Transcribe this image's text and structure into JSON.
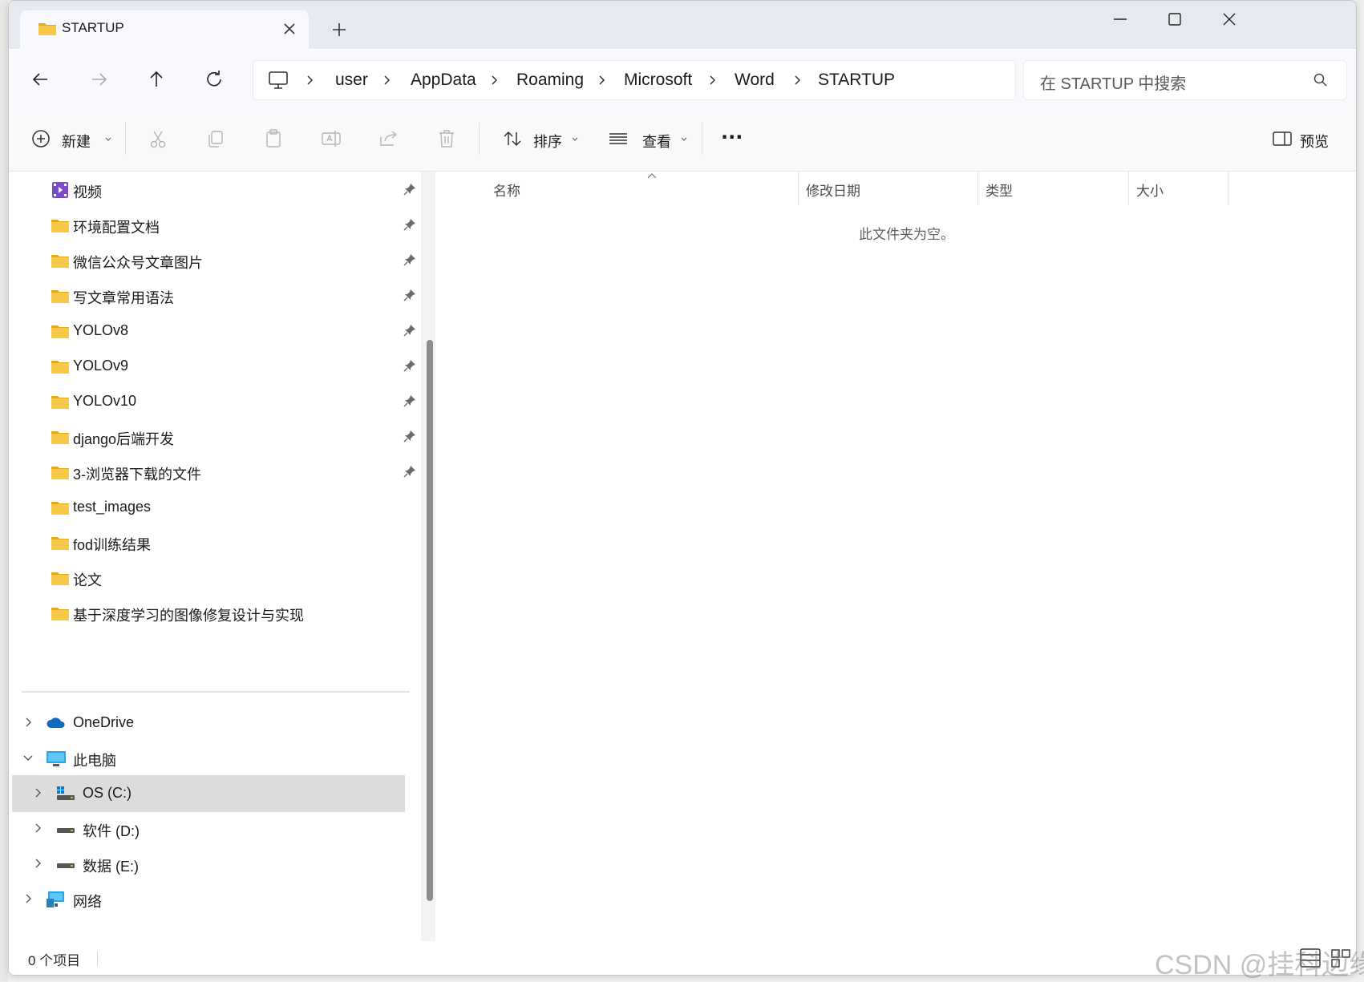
{
  "window": {
    "tab_title": "STARTUP",
    "new_tab_symbol": "+"
  },
  "address_bar": {
    "crumbs": [
      "user",
      "AppData",
      "Roaming",
      "Microsoft",
      "Word",
      "STARTUP"
    ]
  },
  "search": {
    "placeholder": "在 STARTUP 中搜索"
  },
  "toolbar": {
    "new_label": "新建",
    "sort_label": "排序",
    "view_label": "查看",
    "more_label": "···",
    "preview_label": "预览"
  },
  "sidebar": {
    "quick_access": [
      {
        "label": "视频",
        "icon": "video-folder-icon",
        "pinned": true
      },
      {
        "label": "环境配置文档",
        "icon": "folder-icon",
        "pinned": true
      },
      {
        "label": "微信公众号文章图片",
        "icon": "folder-icon",
        "pinned": true
      },
      {
        "label": "写文章常用语法",
        "icon": "folder-icon",
        "pinned": true
      },
      {
        "label": "YOLOv8",
        "icon": "folder-icon",
        "pinned": true
      },
      {
        "label": "YOLOv9",
        "icon": "folder-icon",
        "pinned": true
      },
      {
        "label": "YOLOv10",
        "icon": "folder-icon",
        "pinned": true
      },
      {
        "label": "django后端开发",
        "icon": "folder-icon",
        "pinned": true
      },
      {
        "label": "3-浏览器下载的文件",
        "icon": "folder-icon",
        "pinned": true
      },
      {
        "label": "test_images",
        "icon": "folder-icon",
        "pinned": false
      },
      {
        "label": "fod训练结果",
        "icon": "folder-icon",
        "pinned": false
      },
      {
        "label": "论文",
        "icon": "folder-icon",
        "pinned": false
      },
      {
        "label": "基于深度学习的图像修复设计与实现",
        "icon": "folder-icon",
        "pinned": false
      }
    ],
    "tree": [
      {
        "label": "OneDrive",
        "icon": "onedrive-icon",
        "expanded": false
      },
      {
        "label": "此电脑",
        "icon": "this-pc-icon",
        "expanded": true
      },
      {
        "label": "OS (C:)",
        "icon": "os-drive-icon",
        "selected": true
      },
      {
        "label": "软件 (D:)",
        "icon": "drive-icon",
        "selected": false
      },
      {
        "label": "数据 (E:)",
        "icon": "drive-icon",
        "selected": false
      },
      {
        "label": "网络",
        "icon": "network-icon",
        "expanded": false
      }
    ]
  },
  "content": {
    "columns": [
      "名称",
      "修改日期",
      "类型",
      "大小"
    ],
    "empty_message": "此文件夹为空。"
  },
  "status": {
    "item_count": "0 个项目"
  },
  "watermark": "CSDN @挂科边缘",
  "colors": {
    "folder": "#f7c948",
    "folder_dark": "#e8a919",
    "selection": "#dcdcdc",
    "accent": "#0067c0"
  }
}
